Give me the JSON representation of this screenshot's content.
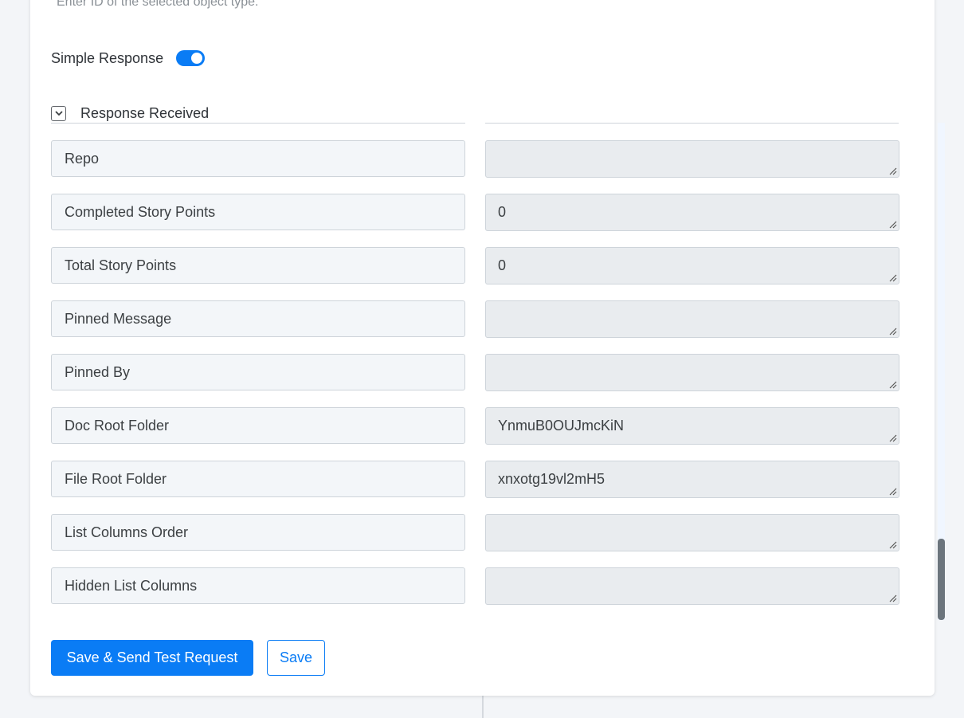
{
  "form": {
    "object_id_hint": "Enter ID of the selected object type.",
    "simple_response_label": "Simple Response",
    "simple_response_enabled": true,
    "response_received_label": "Response Received",
    "response_received_expanded": true
  },
  "fields": [
    {
      "key": "Repo",
      "value": ""
    },
    {
      "key": "Completed Story Points",
      "value": "0"
    },
    {
      "key": "Total Story Points",
      "value": "0"
    },
    {
      "key": "Pinned Message",
      "value": ""
    },
    {
      "key": "Pinned By",
      "value": ""
    },
    {
      "key": "Doc Root Folder",
      "value": "YnmuB0OUJmcKiN"
    },
    {
      "key": "File Root Folder",
      "value": "xnxotg19vl2mH5"
    },
    {
      "key": "List Columns Order",
      "value": ""
    },
    {
      "key": "Hidden List Columns",
      "value": ""
    }
  ],
  "actions": {
    "save_send_label": "Save & Send Test Request",
    "save_label": "Save"
  },
  "colors": {
    "accent": "#0a7cf5",
    "page_bg": "#f3f5f8",
    "key_bg": "#f3f6f9",
    "value_bg": "#e9ecef",
    "border": "#ced4da"
  }
}
